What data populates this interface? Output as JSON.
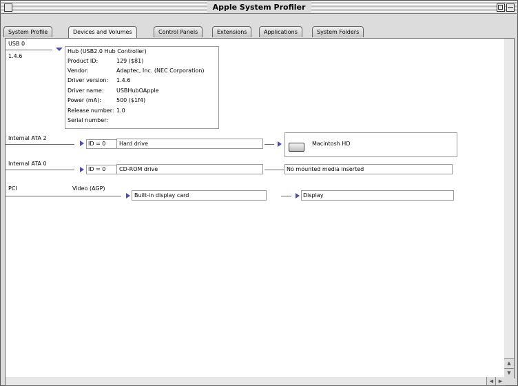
{
  "window": {
    "title": "Apple System Profiler"
  },
  "tabs": [
    {
      "label": "System Profile"
    },
    {
      "label": "Devices and Volumes"
    },
    {
      "label": "Control Panels"
    },
    {
      "label": "Extensions"
    },
    {
      "label": "Applications"
    },
    {
      "label": "System Folders"
    }
  ],
  "active_tab": "Devices and Volumes",
  "usb": {
    "bus": "USB 0",
    "version": "1.4.6",
    "hub": {
      "name": "Hub (USB2.0 Hub Controller)",
      "product_id_label": "Product ID:",
      "product_id_value": "129 ($81)",
      "vendor_label": "Vendor:",
      "vendor_value": "Adaptec, Inc. (NEC Corporation)",
      "driver_version_label": "Driver version:",
      "driver_version_value": "1.4.6",
      "driver_name_label": "Driver name:",
      "driver_name_value": "USBHubOApple",
      "power_label": "Power (mA):",
      "power_value": "500 ($1f4)",
      "release_label": "Release number:",
      "release_value": "1.0",
      "serial_label": "Serial number:",
      "serial_value": ""
    }
  },
  "ata2": {
    "bus": "Internal ATA 2",
    "id": "ID = 0",
    "device": "Hard drive",
    "volume": "Macintosh HD"
  },
  "ata0": {
    "bus": "Internal ATA 0",
    "id": "ID = 0",
    "device": "CD-ROM drive",
    "volume": "No mounted media inserted"
  },
  "pci": {
    "bus": "PCI",
    "slot": "Video (AGP)",
    "card": "Built-in display card",
    "display": "Display"
  },
  "icons": {
    "hard_disk": "hard-disk-icon",
    "disclosure": "disclosure-triangle-icon"
  },
  "colors": {
    "disclosure": "#4a4ab0"
  }
}
